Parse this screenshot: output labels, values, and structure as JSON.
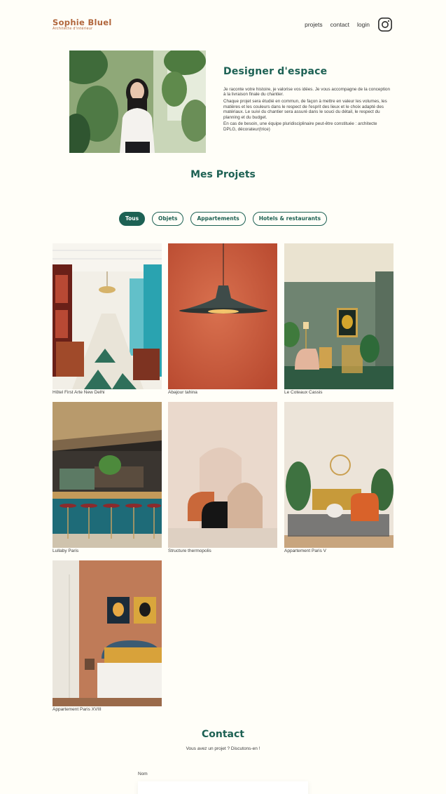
{
  "brand": {
    "name": "Sophie Bluel",
    "subtitle": "Architecte d'intérieur"
  },
  "nav": {
    "items": [
      "projets",
      "contact",
      "login"
    ],
    "instagram_icon": "instagram-icon"
  },
  "intro": {
    "title": "Designer d'espace",
    "paragraphs": [
      "Je raconte votre histoire, je valorise vos idées. Je vous accompagne de la conception à la livraison finale du chantier.",
      "Chaque projet sera étudié en commun, de façon à mettre en valeur les volumes, les matières et les couleurs dans le respect de l'esprit des lieux et le choix adapté des matériaux. Le suivi du chantier sera assuré dans le souci du détail, le respect du planning et du budget.",
      "En cas de besoin, une équipe pluridisciplinaire peut-être constituée : architecte DPLG, décorateur(trice)"
    ]
  },
  "projects": {
    "title": "Mes Projets",
    "filters": [
      "Tous",
      "Objets",
      "Appartements",
      "Hotels & restaurants"
    ],
    "active_filter": "Tous",
    "items": [
      "Hôtel First Arte New Delhi",
      "Abajour tahina",
      "Le Coteaux Cassis",
      "Lullaby Paris",
      "Structure thermopolis",
      "Appartement Paris V",
      "Appartement Paris XVIII"
    ]
  },
  "contact": {
    "title": "Contact",
    "subtitle": "Vous avez un projet ? Discutons-en !",
    "name_label": "Nom"
  },
  "colors": {
    "accent": "#1D6154",
    "brand": "#B1663C",
    "background": "#FFFEF8"
  }
}
